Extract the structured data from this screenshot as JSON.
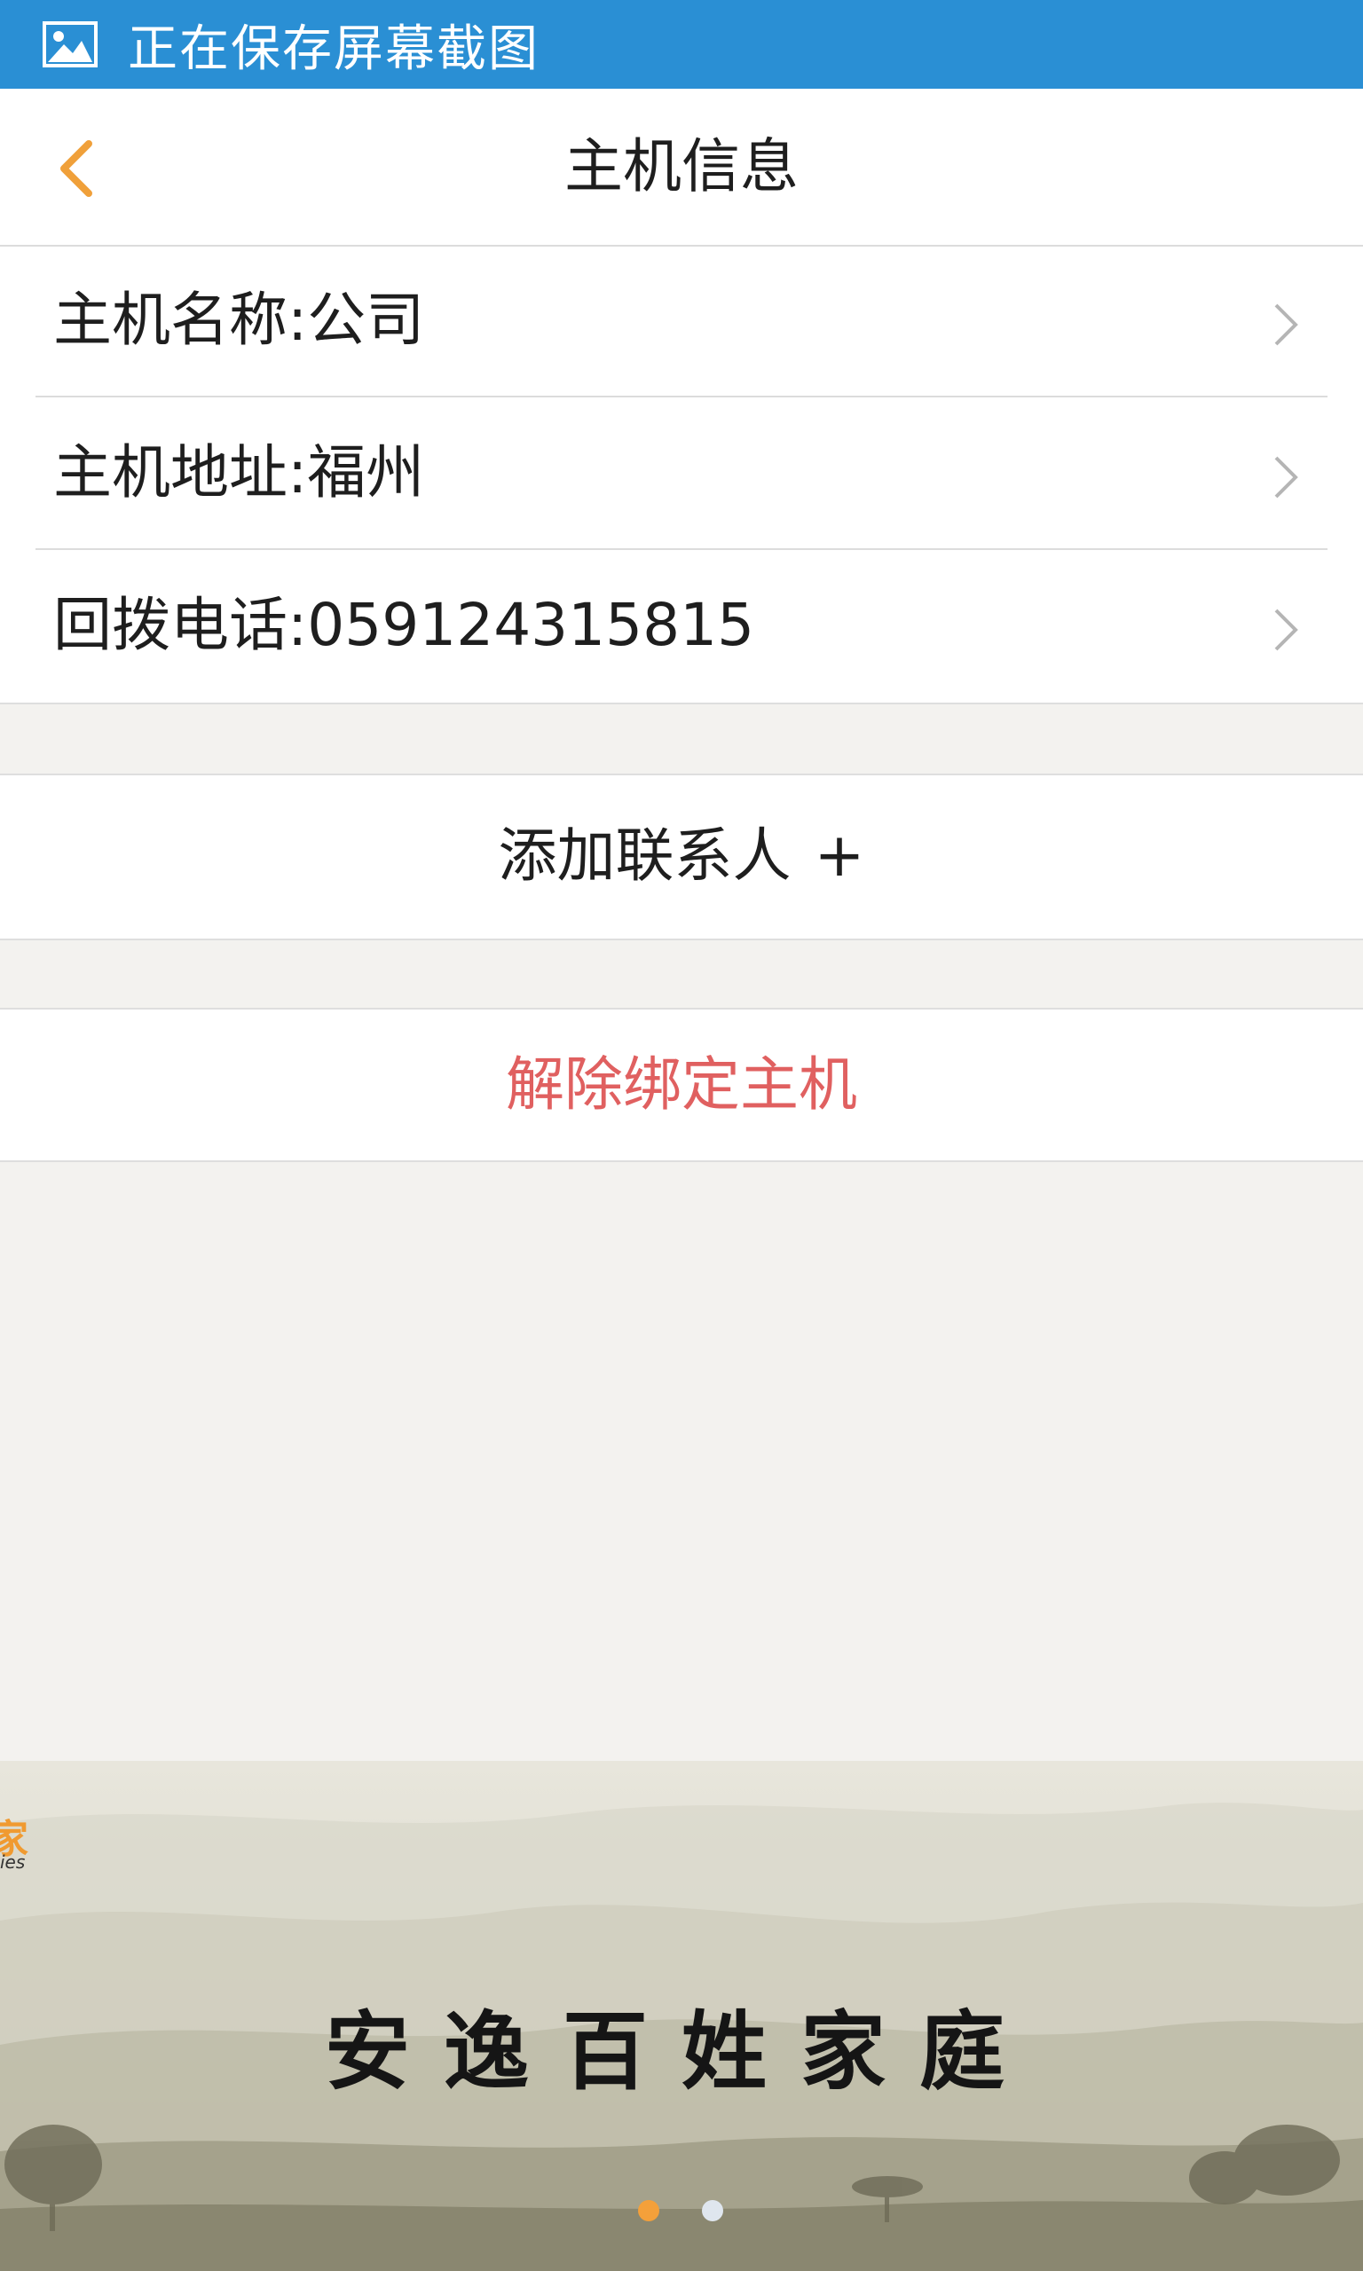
{
  "status_bar": {
    "text": "正在保存屏幕截图",
    "icon": "image-icon"
  },
  "nav": {
    "title": "主机信息",
    "back_icon": "chevron-left-icon",
    "accent_color": "#f0a03a"
  },
  "host_info": {
    "items": [
      {
        "label": "主机名称:公司",
        "icon": "chevron-right-icon"
      },
      {
        "label": "主机地址:福州",
        "icon": "chevron-right-icon"
      },
      {
        "label": "回拨电话:059124315815",
        "icon": "chevron-right-icon"
      }
    ]
  },
  "actions": {
    "add_contact_label": "添加联系人",
    "add_contact_plus": "+",
    "unbind_label": "解除绑定主机",
    "unbind_color": "#e06060"
  },
  "banner": {
    "logo_fragment": "家",
    "logo_sub": "ies",
    "slogan": "安逸百姓家庭",
    "pagination": {
      "total": 2,
      "active": 1
    },
    "active_dot_color": "#f4a03a"
  }
}
